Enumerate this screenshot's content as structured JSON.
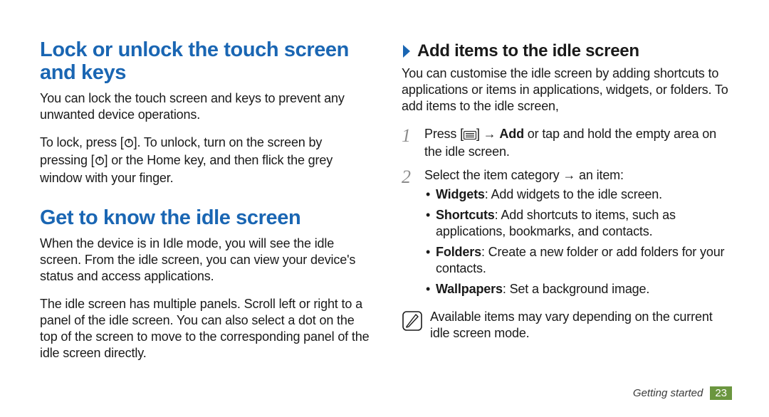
{
  "left": {
    "h1": "Lock or unlock the touch screen and keys",
    "p1": "You can lock the touch screen and keys to prevent any unwanted device operations.",
    "p2a": "To lock, press [",
    "p2b": "]. To unlock, turn on the screen by pressing [",
    "p2c": "] or the Home key, and then flick the grey window with your finger.",
    "h2": "Get to know the idle screen",
    "p3": "When the device is in Idle mode, you will see the idle screen. From the idle screen, you can view your device's status and access applications.",
    "p4": "The idle screen has multiple panels. Scroll left or right to a panel of the idle screen. You can also select a dot on the top of the screen to move to the corresponding panel of the idle screen directly."
  },
  "right": {
    "h2": "Add items to the idle screen",
    "p1": "You can customise the idle screen by adding shortcuts to applications or items in applications, widgets, or folders. To add items to the idle screen,",
    "step1_a": "Press [",
    "step1_b": "] → ",
    "step1_bold": "Add",
    "step1_c": " or tap and hold the empty area on the idle screen.",
    "step2": "Select the item category → an item:",
    "bullets": {
      "b1k": "Widgets",
      "b1v": ": Add widgets to the idle screen.",
      "b2k": "Shortcuts",
      "b2v": ": Add shortcuts to items, such as applications, bookmarks, and contacts.",
      "b3k": "Folders",
      "b3v": ": Create a new folder or add folders for your contacts.",
      "b4k": "Wallpapers",
      "b4v": ": Set a background image."
    },
    "note": "Available items may vary depending on the current idle screen mode."
  },
  "footer": {
    "section": "Getting started",
    "page": "23"
  }
}
